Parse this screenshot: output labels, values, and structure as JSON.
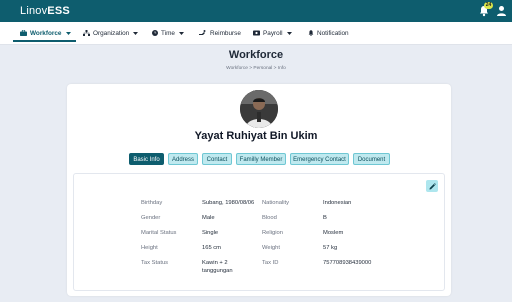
{
  "app": {
    "logo_prefix": "Linov",
    "logo_suffix": "ESS",
    "notification_count": "24"
  },
  "nav": [
    {
      "label": "Workforce",
      "icon": "briefcase-icon"
    },
    {
      "label": "Organization",
      "icon": "org-chart-icon"
    },
    {
      "label": "Time",
      "icon": "clock-icon"
    },
    {
      "label": "Reimburse",
      "icon": "reimburse-icon"
    },
    {
      "label": "Payroll",
      "icon": "wallet-icon"
    },
    {
      "label": "Notification",
      "icon": "bell-icon"
    }
  ],
  "page": {
    "title": "Workforce",
    "breadcrumb": "Workforce > Personal > Info"
  },
  "profile": {
    "name": "Yayat Ruhiyat Bin Ukim"
  },
  "tabs": [
    "Basic Info",
    "Address",
    "Contact",
    "Familly Member",
    "Emergency Contact",
    "Document"
  ],
  "active_tab": "Basic Info",
  "details": {
    "birthday": {
      "label": "Birthday",
      "value": "Subang, 1980/08/06"
    },
    "gender": {
      "label": "Gender",
      "value": "Male"
    },
    "marital": {
      "label": "Marital Status",
      "value": "Single"
    },
    "height": {
      "label": "Height",
      "value": "165 cm"
    },
    "tax_status": {
      "label": "Tax Status",
      "value_line1": "Kawin + 2",
      "value_line2": "tanggungan"
    },
    "nationality": {
      "label": "Nationality",
      "value": "Indonesian"
    },
    "blood": {
      "label": "Blood",
      "value": "B"
    },
    "religion": {
      "label": "Religion",
      "value": "Moslem"
    },
    "weight": {
      "label": "Weight",
      "value": "57 kg"
    },
    "tax_id": {
      "label": "Tax ID",
      "value": "757708938439000"
    }
  },
  "colors": {
    "brand": "#0e5d6e",
    "tab_bg": "#bfe9ef",
    "badge": "#d9e64c",
    "page_bg": "#e8ecf3"
  }
}
